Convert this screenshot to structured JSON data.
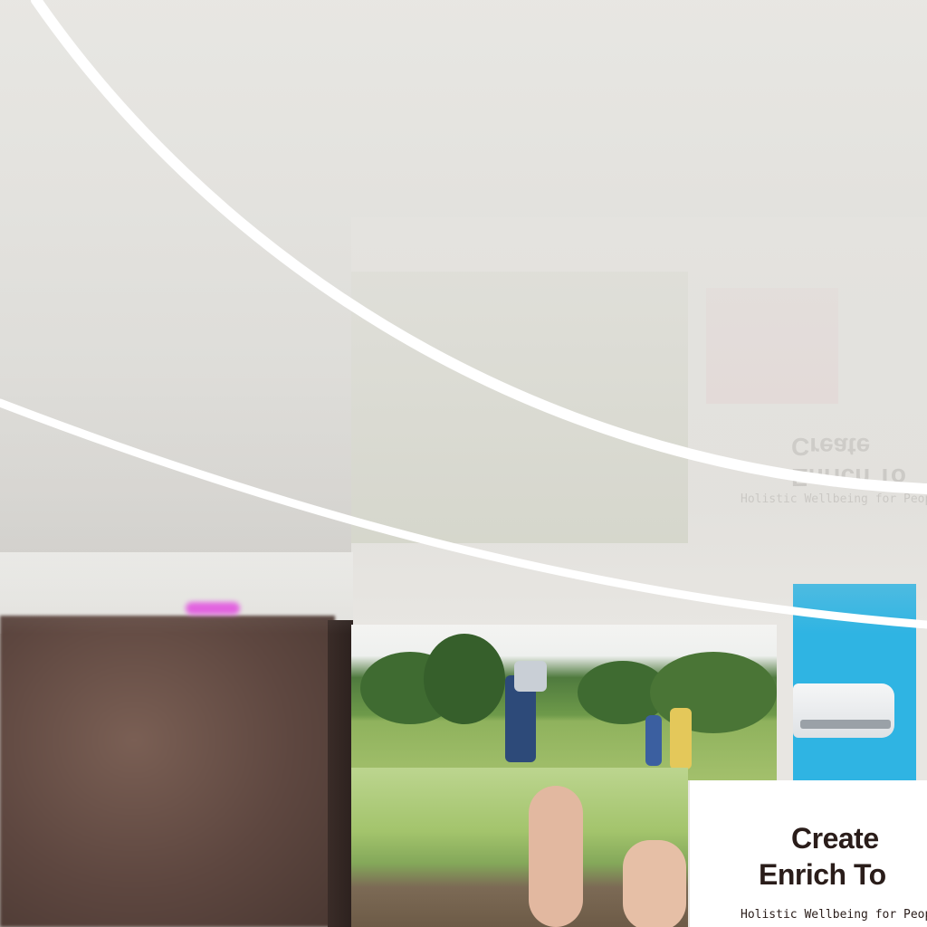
{
  "hero": {
    "headline_line1": "Create",
    "headline_line2": "Enrich To",
    "subtitle": "Holistic Wellbeing for Peop"
  },
  "reflection": {
    "subtitle": "Holistic Wellbeing for Peop",
    "headline_line1": "Enrich To",
    "headline_line2": "Create"
  },
  "colors": {
    "accent_glow": "#e23ee0",
    "printer_panel": "#2fb4e3",
    "headline_text": "#2a1d1a"
  },
  "images": {
    "park_photo": "family-playing-in-park",
    "hands_photo": "hands-on-wooden-railing",
    "printer_photo": "printer-on-blue-background"
  }
}
